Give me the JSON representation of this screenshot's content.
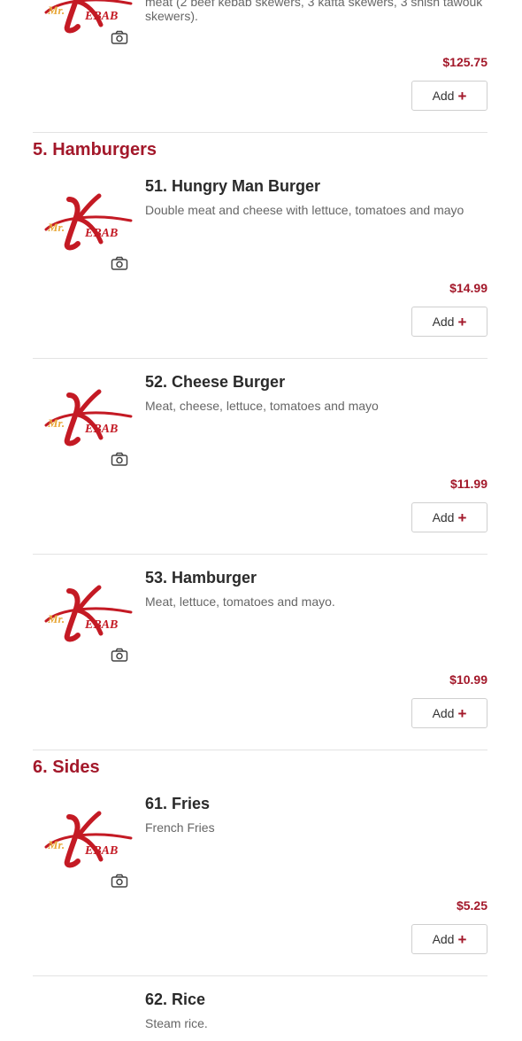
{
  "add_label": "Add",
  "sections": [
    {
      "title": "5. Hamburgers"
    },
    {
      "title": "6. Sides"
    }
  ],
  "top_item": {
    "description": "meat (2 beef kebab skewers, 3 kafta skewers, 3 shish tawouk skewers).",
    "price": "$125.75"
  },
  "items": [
    {
      "name": "51. Hungry Man Burger",
      "description": "Double meat and cheese with lettuce, tomatoes and mayo",
      "price": "$14.99"
    },
    {
      "name": "52. Cheese Burger",
      "description": "Meat, cheese, lettuce, tomatoes and mayo",
      "price": "$11.99"
    },
    {
      "name": "53. Hamburger",
      "description": "Meat, lettuce, tomatoes and mayo.",
      "price": "$10.99"
    },
    {
      "name": "61. Fries",
      "description": "French Fries",
      "price": "$5.25"
    },
    {
      "name": "62. Rice",
      "description": "Steam rice."
    }
  ],
  "logo": {
    "top": "Mr.",
    "bottom": "EBAB",
    "accent_color": "#c41a24",
    "gold_color": "#e8a83a"
  },
  "colors": {
    "price": "#a3182a",
    "section": "#a3182a"
  }
}
